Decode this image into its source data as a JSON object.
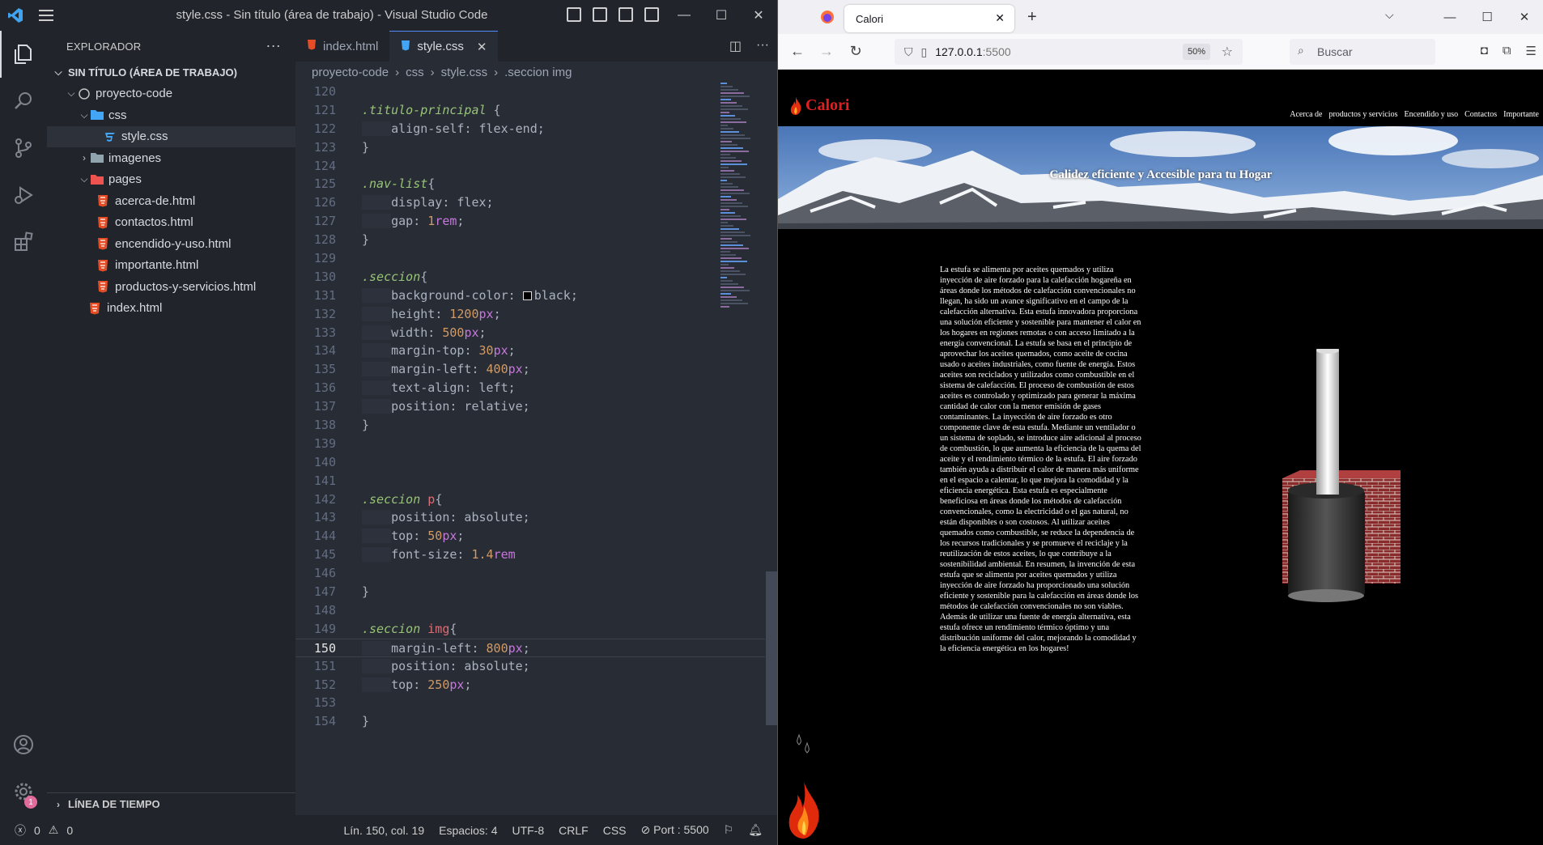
{
  "vscode": {
    "window_title": "style.css - Sin título (área de trabajo) - Visual Studio Code",
    "menu_icon": "hamburger-icon",
    "explorer": {
      "header": "EXPLORADOR",
      "workspace": "SIN TÍTULO (ÁREA DE TRABAJO)",
      "tree": [
        {
          "label": "proyecto-code",
          "kind": "root"
        },
        {
          "label": "css",
          "kind": "folder-open"
        },
        {
          "label": "style.css",
          "kind": "css"
        },
        {
          "label": "imagenes",
          "kind": "folder-closed"
        },
        {
          "label": "pages",
          "kind": "folder-open"
        },
        {
          "label": "acerca-de.html",
          "kind": "html"
        },
        {
          "label": "contactos.html",
          "kind": "html"
        },
        {
          "label": "encendido-y-uso.html",
          "kind": "html"
        },
        {
          "label": "importante.html",
          "kind": "html"
        },
        {
          "label": "productos-y-servicios.html",
          "kind": "html"
        },
        {
          "label": "index.html",
          "kind": "html"
        }
      ],
      "timeline": "LÍNEA DE TIEMPO"
    },
    "tabs": [
      {
        "label": "index.html",
        "active": false
      },
      {
        "label": "style.css",
        "active": true
      }
    ],
    "breadcrumb": [
      "proyecto-code",
      "css",
      "style.css",
      ".seccion img"
    ],
    "code_lines": [
      {
        "n": "120",
        "text": ""
      },
      {
        "n": "121",
        "text": ".titulo-principal {"
      },
      {
        "n": "122",
        "text": "    align-self: flex-end;"
      },
      {
        "n": "123",
        "text": "}"
      },
      {
        "n": "124",
        "text": ""
      },
      {
        "n": "125",
        "text": ".nav-list{"
      },
      {
        "n": "126",
        "text": "    display: flex;"
      },
      {
        "n": "127",
        "text": "    gap: 1rem;"
      },
      {
        "n": "128",
        "text": "}"
      },
      {
        "n": "129",
        "text": ""
      },
      {
        "n": "130",
        "text": ".seccion{"
      },
      {
        "n": "131",
        "text": "    background-color: black;"
      },
      {
        "n": "132",
        "text": "    height: 1200px;"
      },
      {
        "n": "133",
        "text": "    width: 500px;"
      },
      {
        "n": "134",
        "text": "    margin-top: 30px;"
      },
      {
        "n": "135",
        "text": "    margin-left: 400px;"
      },
      {
        "n": "136",
        "text": "    text-align: left;"
      },
      {
        "n": "137",
        "text": "    position: relative;"
      },
      {
        "n": "138",
        "text": "}"
      },
      {
        "n": "139",
        "text": ""
      },
      {
        "n": "140",
        "text": ""
      },
      {
        "n": "141",
        "text": ""
      },
      {
        "n": "142",
        "text": ".seccion p{"
      },
      {
        "n": "143",
        "text": "    position: absolute;"
      },
      {
        "n": "144",
        "text": "    top: 50px;"
      },
      {
        "n": "145",
        "text": "    font-size: 1.4rem"
      },
      {
        "n": "146",
        "text": ""
      },
      {
        "n": "147",
        "text": "}"
      },
      {
        "n": "148",
        "text": ""
      },
      {
        "n": "149",
        "text": ".seccion img{"
      },
      {
        "n": "150",
        "text": "    margin-left: 800px;"
      },
      {
        "n": "151",
        "text": "    position: absolute;"
      },
      {
        "n": "152",
        "text": "    top: 250px;"
      },
      {
        "n": "153",
        "text": ""
      },
      {
        "n": "154",
        "text": "}"
      }
    ],
    "current_line": "150",
    "status": {
      "errors": "0",
      "warnings": "0",
      "position": "Lín. 150, col. 19",
      "spaces": "Espacios: 4",
      "encoding": "UTF-8",
      "eol": "CRLF",
      "language": "CSS",
      "port": "Port : 5500"
    },
    "accounts_badge": "1"
  },
  "firefox": {
    "tab_title": "Calori",
    "url_host": "127.0.0.1",
    "url_port": ":5500",
    "zoom": "50%",
    "search_placeholder": "Buscar",
    "page": {
      "logo": "Calori",
      "nav": [
        "Acerca de",
        "productos y servicios",
        "Encendido y uso",
        "Contactos",
        "Importante"
      ],
      "hero_title": "Calidez eficiente y Accesible para tu Hogar",
      "article": "La estufa se alimenta por aceites quemados y utiliza inyección de aire forzado para la calefacción hogareña en áreas donde los métodos de calefacción convencionales no llegan, ha sido un avance significativo en el campo de la calefacción alternativa. Esta estufa innovadora proporciona una solución eficiente y sostenible para mantener el calor en los hogares en regiones remotas o con acceso limitado a la energía convencional. La estufa se basa en el principio de aprovechar los aceites quemados, como aceite de cocina usado o aceites industriales, como fuente de energía. Estos aceites son reciclados y utilizados como combustible en el sistema de calefacción. El proceso de combustión de estos aceites es controlado y optimizado para generar la máxima cantidad de calor con la menor emisión de gases contaminantes. La inyección de aire forzado es otro componente clave de esta estufa. Mediante un ventilador o un sistema de soplado, se introduce aire adicional al proceso de combustión, lo que aumenta la eficiencia de la quema del aceite y el rendimiento térmico de la estufa. El aire forzado también ayuda a distribuir el calor de manera más uniforme en el espacio a calentar, lo que mejora la comodidad y la eficiencia energética. Esta estufa es especialmente beneficiosa en áreas donde los métodos de calefacción convencionales, como la electricidad o el gas natural, no están disponibles o son costosos. Al utilizar aceites quemados como combustible, se reduce la dependencia de los recursos tradicionales y se promueve el reciclaje y la reutilización de estos aceites, lo que contribuye a la sostenibilidad ambiental. En resumen, la invención de esta estufa que se alimenta por aceites quemados y utiliza inyección de aire forzado ha proporcionado una solución eficiente y sostenible para la calefacción en áreas donde los métodos de calefacción convencionales no son viables. Además de utilizar una fuente de energía alternativa, esta estufa ofrece un rendimiento térmico óptimo y una distribución uniforme del calor, mejorando la comodidad y la eficiencia energética en los hogares!"
    }
  }
}
